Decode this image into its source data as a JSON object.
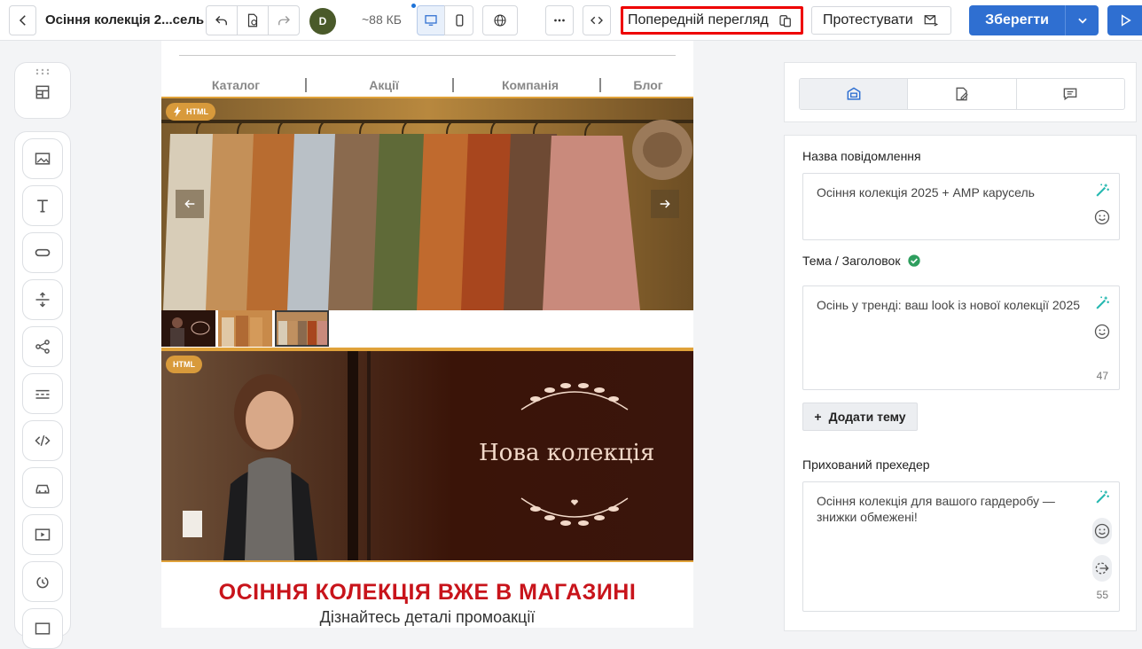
{
  "header": {
    "title": "Осіння колекція 2...сель",
    "avatar_initial": "D",
    "size": "~88 КБ",
    "preview_label": "Попередній перегляд",
    "test_label": "Протестувати",
    "save_label": "Зберегти"
  },
  "email": {
    "nav": [
      "Каталог",
      "Акції",
      "Компанія",
      "Блог"
    ],
    "badge_html": "HTML",
    "banner_title": "Нова колекція",
    "promo_heading": "ОСІННЯ КОЛЕКЦІЯ ВЖЕ В МАГАЗИНІ",
    "promo_subheading": "Дізнайтесь деталі промоакції"
  },
  "panel": {
    "message_name_label": "Назва повідомлення",
    "message_name_value": "Осіння колекція 2025 + AMP карусель",
    "subject_label": "Тема / Заголовок",
    "subject_value": "Осінь у тренді: ваш look із нової колекції 2025",
    "subject_count": "47",
    "add_topic_label": "Додати тему",
    "preheader_label": "Прихований прехедер",
    "preheader_value": "Осіння колекція для вашого гардеробу — знижки обмежені!",
    "preheader_count": "55"
  },
  "colors": {
    "accent": "#2f6fd1",
    "highlight_border": "#e00000",
    "block_border": "#e0a23a",
    "promo_red": "#c8141b"
  }
}
